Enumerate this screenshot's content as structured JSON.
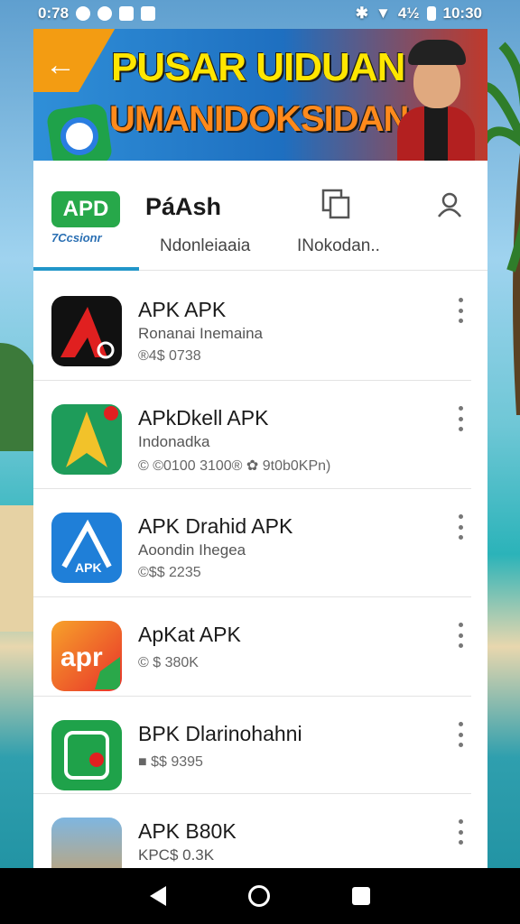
{
  "status_bar": {
    "left_text": "0:78",
    "battery_text": "4½",
    "time": "10:30"
  },
  "banner": {
    "title_line_1": "PUSAR UIDUAN",
    "title_line_2": "UMANIDOKSIDAN",
    "back_icon": "back-arrow-icon"
  },
  "header": {
    "brand_logo_text": "APD",
    "brand_sub": "7Ccsionr",
    "title": "PáAsh",
    "tab_1_label": "Ndonleiaaia",
    "tab_2_label": "INokodan..",
    "icons": [
      "copy-icon",
      "user-icon"
    ],
    "accent_color": "#2196c9"
  },
  "apps": [
    {
      "name": "APK APK",
      "subtitle": "Ronanai Inemaina",
      "meta": "®4$ 0738",
      "icon": "red-a-icon",
      "icon_color": "#111111"
    },
    {
      "name": "APkDkell APK",
      "subtitle": "Indonadka",
      "meta": "© ©0100 3100® ✿ 9t0b0KPn)",
      "icon": "star-arrow-icon",
      "icon_color": "#1e9c5a"
    },
    {
      "name": "APK Drahid APK",
      "subtitle": "Aoondin Ihegea",
      "meta": "©$$ 2235",
      "icon": "blue-a-icon",
      "icon_color": "#1f7fd8"
    },
    {
      "name": "ApKat APK",
      "subtitle": "",
      "meta": "© $ 380K",
      "icon": "apk-text-icon",
      "icon_color": "#f2642a"
    },
    {
      "name": "BPK Dlarinohahni",
      "subtitle": "",
      "meta": "■ $$ 9395",
      "icon": "green-shield-icon",
      "icon_color": "#1fa24a"
    },
    {
      "name": "APK B80K",
      "subtitle": "KPC$ 0.3K",
      "meta": "",
      "icon": "photo-thumbnail-icon",
      "icon_color": "#3a6fa8"
    }
  ]
}
